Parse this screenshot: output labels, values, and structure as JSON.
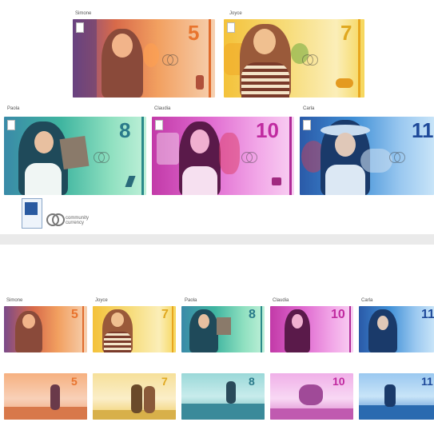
{
  "people": {
    "simone": "Simone",
    "joyce": "Joyce",
    "paola": "Paola",
    "claudia": "Claudia",
    "carla": "Carla"
  },
  "denominations": {
    "simone": "5",
    "joyce": "7",
    "paola": "8",
    "claudia": "10",
    "carla": "11"
  },
  "brand": {
    "logo_text": "community currency",
    "note_text": "community currency"
  },
  "colors": {
    "simone": "#f07a3a",
    "joyce": "#f2c94c",
    "paola": "#3fb58f",
    "claudia": "#d64fc8",
    "carla": "#3f8fd6"
  }
}
